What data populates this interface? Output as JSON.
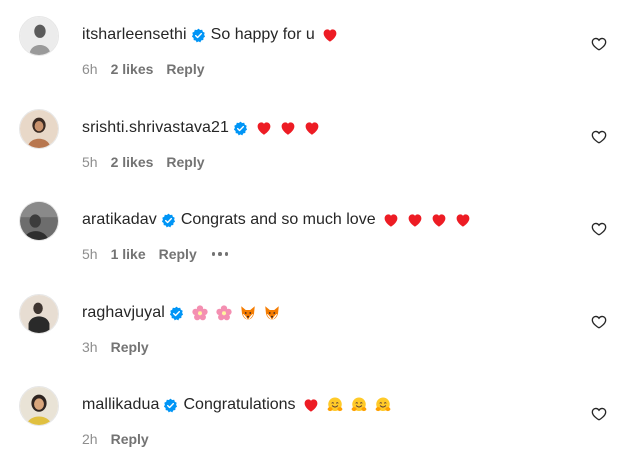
{
  "comments": [
    {
      "username": "itsharleensethi",
      "verified": true,
      "text": "So happy for u",
      "emojis": [
        "red-heart"
      ],
      "time": "6h",
      "likes": "2 likes",
      "reply": "Reply",
      "avatar_tone": "#cfcfcf"
    },
    {
      "username": "srishti.shrivastava21",
      "verified": true,
      "text": "",
      "emojis": [
        "red-heart",
        "red-heart",
        "red-heart"
      ],
      "time": "5h",
      "likes": "2 likes",
      "reply": "Reply",
      "avatar_tone": "#b88a6a"
    },
    {
      "username": "aratikadav",
      "verified": true,
      "text": "Congrats and so much love",
      "emojis": [
        "red-heart",
        "red-heart",
        "red-heart",
        "red-heart"
      ],
      "time": "5h",
      "likes": "1 like",
      "reply": "Reply",
      "more_options": true,
      "avatar_tone": "#5a5a5a"
    },
    {
      "username": "raghavjuyal",
      "verified": true,
      "text": "",
      "emojis": [
        "pink-flower",
        "pink-flower",
        "fox-face",
        "fox-face"
      ],
      "time": "3h",
      "likes": "",
      "reply": "Reply",
      "avatar_tone": "#c9b8a6"
    },
    {
      "username": "mallikadua",
      "verified": true,
      "text": "Congratulations",
      "emojis": [
        "red-heart",
        "hugging-face",
        "hugging-face",
        "hugging-face"
      ],
      "time": "2h",
      "likes": "",
      "reply": "Reply",
      "avatar_tone": "#d7b36b"
    }
  ],
  "colors": {
    "text": "#262626",
    "meta": "#737373",
    "verified_blue": "#0095f6",
    "heart_red": "#ed1c24"
  },
  "icons": {
    "verified": "verified-badge-icon",
    "like": "heart-outline-icon",
    "more": "more-horizontal-icon"
  }
}
